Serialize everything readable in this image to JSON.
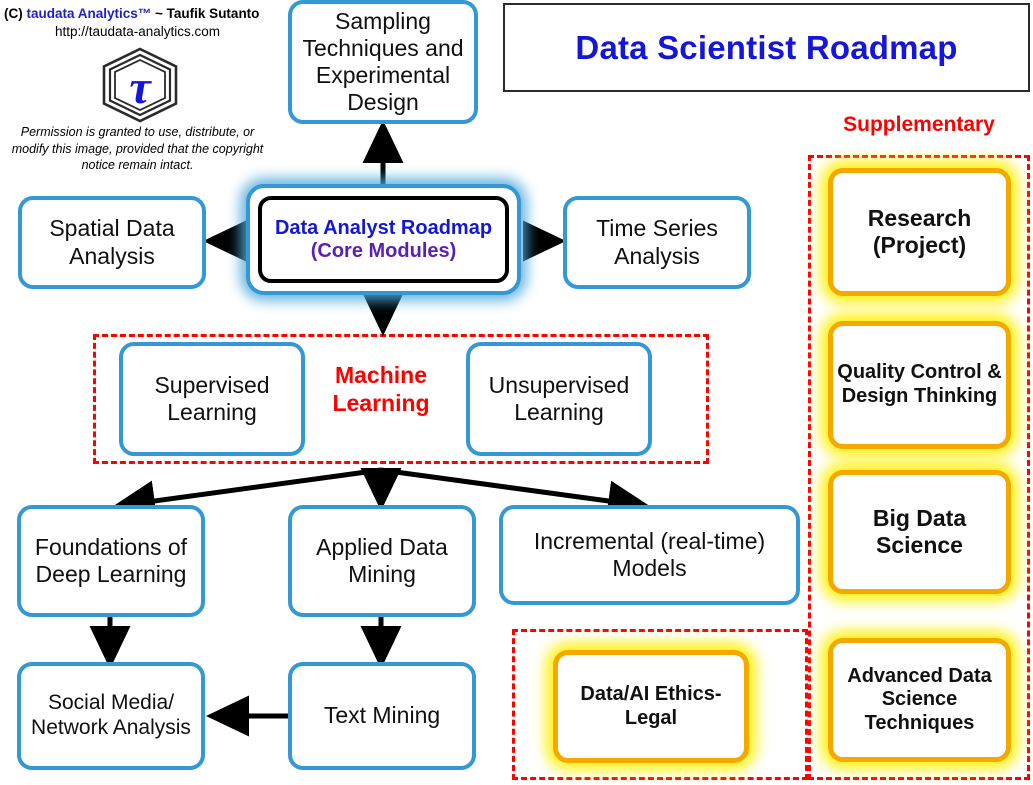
{
  "credit": {
    "line1_prefix": "(C) ",
    "line1_brand": "taudata Analytics™",
    "line1_suffix": " ~ Taufik Sutanto",
    "url": "http://taudata-analytics.com",
    "permission": "Permission is granted to use, distribute, or modify this image, provided that the copyright notice remain intact.",
    "logo_glyph": "τ"
  },
  "header": {
    "title": "Data Scientist Roadmap",
    "supplementary_label": "Supplementary"
  },
  "core": {
    "line1": "Data Analyst Roadmap",
    "line2": "(Core Modules)"
  },
  "nodes": {
    "sampling": "Sampling Techniques and Experimental Design",
    "spatial": "Spatial Data Analysis",
    "timeseries": "Time Series Analysis",
    "supervised": "Supervised Learning",
    "unsupervised": "Unsupervised Learning",
    "machine_learning": "Machine Learning",
    "foundations": "Foundations of Deep Learning",
    "applied": "Applied Data Mining",
    "incremental": "Incremental (real-time) Models",
    "social": "Social Media/ Network Analysis",
    "text_mining": "Text Mining",
    "ethics": "Data/AI Ethics-Legal"
  },
  "supplementary": [
    {
      "label": "Research (Project)"
    },
    {
      "label": "Quality Control & Design Thinking"
    },
    {
      "label": "Big Data Science"
    },
    {
      "label": "Advanced Data Science Techniques"
    }
  ],
  "colors": {
    "blue_border": "#3498d5",
    "blue_text": "#1616d8",
    "purple_text": "#5b1fb4",
    "red_dashed": "#fe0000",
    "gold_border": "#F5A800",
    "glow_yellow": "#fff000"
  }
}
